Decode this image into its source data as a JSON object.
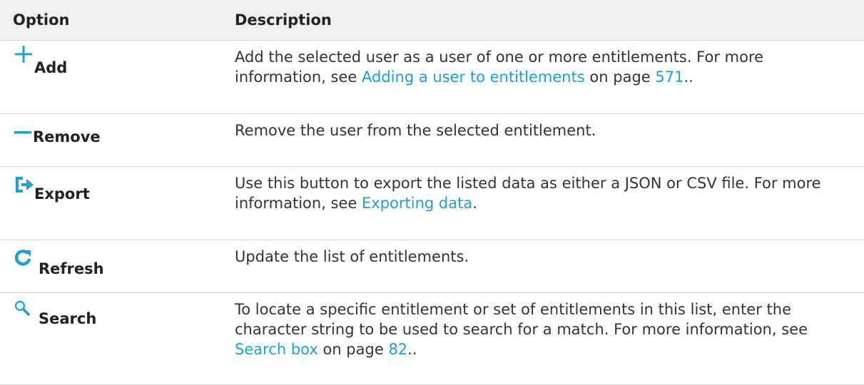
{
  "header": {
    "option": "Option",
    "description": "Description"
  },
  "colors": {
    "accent": "#1e9fd6",
    "header_bg": "#f0f0f0",
    "text": "#222222",
    "border": "#d4d4d4"
  },
  "rows": [
    {
      "icon": "plus-icon",
      "label": "Add",
      "desc_pre": "Add the selected user as a user of one or more entitlements. For more information, see ",
      "link": "Adding a user to entitlements",
      "desc_mid": " on page ",
      "page": "571",
      "desc_post": ".."
    },
    {
      "icon": "minus-icon",
      "label": "Remove",
      "desc": "Remove the user from the selected entitlement."
    },
    {
      "icon": "export-icon",
      "label": "Export",
      "desc_pre": "Use this button to export the listed data as either a JSON or CSV file. For more information, see ",
      "link": "Exporting data",
      "desc_post": "."
    },
    {
      "icon": "refresh-icon",
      "label": "Refresh",
      "desc": "Update the list of entitlements."
    },
    {
      "icon": "search-icon",
      "label": "Search",
      "desc_pre": "To locate a specific entitlement or set of entitlements in this list, enter the character string to be used to search for a match. For more information, see ",
      "link": "Search box",
      "desc_mid": " on page ",
      "page": "82",
      "desc_post": ".."
    }
  ]
}
